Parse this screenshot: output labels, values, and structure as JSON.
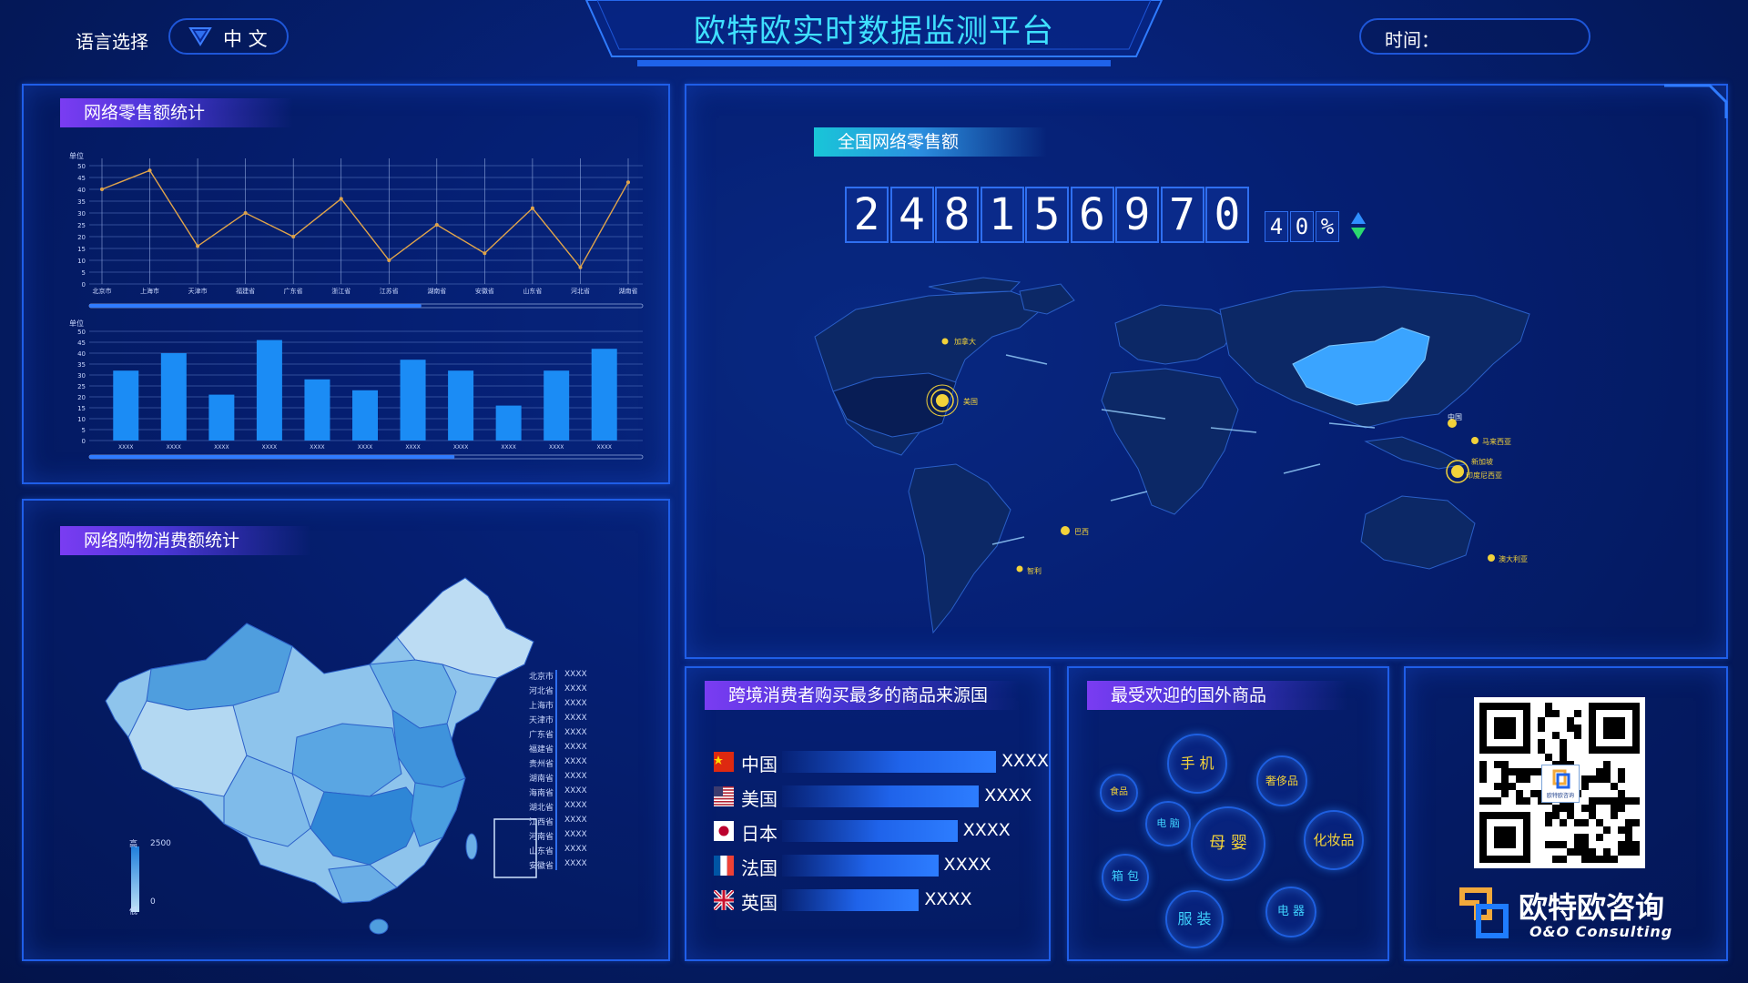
{
  "header": {
    "language_label": "语言选择",
    "language_value": "中 文",
    "title": "欧特欧实时数据监测平台",
    "time_label": "时间："
  },
  "retail_panel": {
    "title": "网络零售额统计"
  },
  "shopping_panel": {
    "title": "网络购物消费额统计",
    "map_legend": {
      "high_label": "高",
      "low_label": "低",
      "max_value": "2500",
      "min_value": "0",
      "provinces": [
        {
          "name": "北京市",
          "value": "XXXX"
        },
        {
          "name": "河北省",
          "value": "XXXX"
        },
        {
          "name": "上海市",
          "value": "XXXX"
        },
        {
          "name": "天津市",
          "value": "XXXX"
        },
        {
          "name": "广东省",
          "value": "XXXX"
        },
        {
          "name": "福建省",
          "value": "XXXX"
        },
        {
          "name": "贵州省",
          "value": "XXXX"
        },
        {
          "name": "湖南省",
          "value": "XXXX"
        },
        {
          "name": "海南省",
          "value": "XXXX"
        },
        {
          "name": "湖北省",
          "value": "XXXX"
        },
        {
          "name": "江西省",
          "value": "XXXX"
        },
        {
          "name": "河南省",
          "value": "XXXX"
        },
        {
          "name": "山东省",
          "value": "XXXX"
        },
        {
          "name": "安徽省",
          "value": "XXXX"
        }
      ]
    }
  },
  "national_panel": {
    "title": "全国网络零售额",
    "total_digits": [
      "2",
      "4",
      "8",
      "1",
      "5",
      "6",
      "9",
      "7",
      "0"
    ],
    "percent_digits": [
      "4",
      "0",
      "%"
    ],
    "map_labels": [
      {
        "name": "加拿大"
      },
      {
        "name": "美国"
      },
      {
        "name": "巴西"
      },
      {
        "name": "智利"
      },
      {
        "name": "中国"
      },
      {
        "name": "新加坡"
      },
      {
        "name": "马来西亚"
      },
      {
        "name": "印度尼西亚"
      },
      {
        "name": "澳大利亚"
      }
    ]
  },
  "origin_panel": {
    "title": "跨境消费者购买最多的商品来源国",
    "rows": [
      {
        "country": "中国",
        "value": "XXXX",
        "fraction": 1.0
      },
      {
        "country": "美国",
        "value": "XXXX",
        "fraction": 0.92
      },
      {
        "country": "日本",
        "value": "XXXX",
        "fraction": 0.82
      },
      {
        "country": "法国",
        "value": "XXXX",
        "fraction": 0.73
      },
      {
        "country": "英国",
        "value": "XXXX",
        "fraction": 0.64
      }
    ]
  },
  "products_panel": {
    "title": "最受欢迎的国外商品",
    "items": [
      "手 机",
      "奢侈品",
      "食品",
      "电 脑",
      "母 婴",
      "化妆品",
      "箱 包",
      "服 装",
      "电 器"
    ]
  },
  "brand": {
    "name": "欧特欧咨询",
    "name_en": "O&O Consulting",
    "qr_caption": "欧特欧咨询"
  },
  "colors": {
    "accent_blue": "#1f63ea",
    "bar_blue": "#1b8cf5",
    "line_orange": "#e0a44a",
    "highlight_gold": "#f2d23a",
    "china_map_blue": "#3aa4ff"
  },
  "chart_data": [
    {
      "type": "line",
      "title": "",
      "ylabel": "单位",
      "categories": [
        "北京市",
        "上海市",
        "天津市",
        "福建省",
        "广东省",
        "浙江省",
        "江苏省",
        "湖南省",
        "安徽省",
        "山东省",
        "河北省",
        "湖南省"
      ],
      "values": [
        40,
        48,
        16,
        30,
        20,
        36,
        10,
        25,
        13,
        32,
        7,
        43
      ],
      "ylim": [
        0,
        50
      ],
      "yticks": [
        0,
        5,
        10,
        15,
        20,
        25,
        30,
        35,
        40,
        45,
        50
      ],
      "grid": true,
      "scrollbar_fraction": 0.6
    },
    {
      "type": "bar",
      "title": "",
      "ylabel": "单位",
      "categories": [
        "XXXX",
        "XXXX",
        "XXXX",
        "XXXX",
        "XXXX",
        "XXXX",
        "XXXX",
        "XXXX",
        "XXXX",
        "XXXX",
        "XXXX"
      ],
      "values": [
        32,
        40,
        21,
        46,
        28,
        23,
        37,
        32,
        16,
        32,
        42
      ],
      "ylim": [
        0,
        50
      ],
      "yticks": [
        0,
        5,
        10,
        15,
        20,
        25,
        30,
        35,
        40,
        45,
        50
      ],
      "grid": true,
      "scrollbar_fraction": 0.66
    }
  ]
}
